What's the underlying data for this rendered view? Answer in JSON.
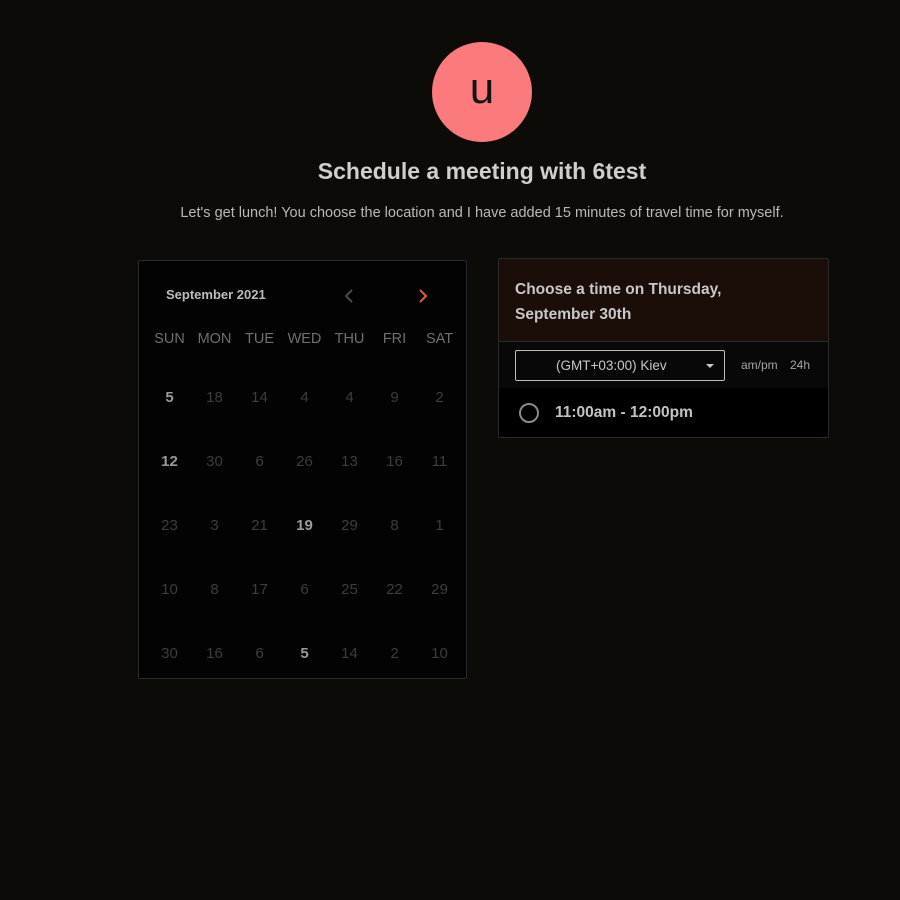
{
  "avatar": {
    "initial": "u",
    "color": "#fb7a7e"
  },
  "header": {
    "title": "Schedule a meeting with 6test",
    "description": "Let's get lunch! You choose the location and I have added 15 minutes of travel time for myself."
  },
  "calendar": {
    "month_label": "September 2021",
    "prev_icon": "chevron-left-icon",
    "next_icon": "chevron-right-icon",
    "accent_color": "#e0602c",
    "weekdays": [
      "SUN",
      "MON",
      "TUE",
      "WED",
      "THU",
      "FRI",
      "SAT"
    ],
    "weeks": [
      [
        "5",
        "18",
        "14",
        "4",
        "4",
        "9",
        "2"
      ],
      [
        "12",
        "30",
        "6",
        "26",
        "13",
        "16",
        "11"
      ],
      [
        "23",
        "3",
        "21",
        "19",
        "29",
        "8",
        "1"
      ],
      [
        "10",
        "8",
        "17",
        "6",
        "25",
        "22",
        "29"
      ],
      [
        "30",
        "16",
        "6",
        "5",
        "14",
        "2",
        "10"
      ]
    ]
  },
  "time_panel": {
    "heading_line1": "Choose a time on Thursday,",
    "heading_line2": "September 30th",
    "timezone": "(GMT+03:00) Kiev",
    "format_ampm": "am/pm",
    "format_24h": "24h",
    "slots": [
      {
        "label": "11:00am - 12:00pm"
      }
    ]
  }
}
